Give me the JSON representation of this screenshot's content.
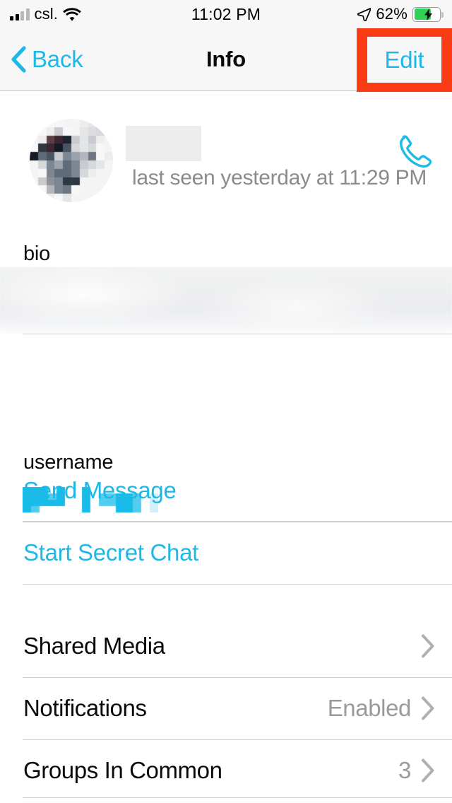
{
  "status_bar": {
    "carrier": "csl.",
    "time": "11:02 PM",
    "battery_percent": "62%",
    "signal_bars_filled": 2,
    "signal_bars_total": 4,
    "wifi_icon": "wifi-icon",
    "location_icon": "location-arrow-icon",
    "battery_icon": "battery-charging-icon",
    "battery_level": 62,
    "charging": true
  },
  "nav": {
    "back_label": "Back",
    "back_icon": "chevron-left-icon",
    "title": "Info",
    "edit_label": "Edit",
    "highlight_color": "#fa3c14"
  },
  "profile": {
    "avatar_icon": "avatar-pixelated",
    "name": "",
    "name_redacted": true,
    "status": "last seen yesterday at 11:29 PM",
    "call_icon": "phone-call-icon"
  },
  "sections": {
    "bio": {
      "label": "bio",
      "value": "",
      "value_redacted": true
    },
    "username": {
      "label": "username",
      "value": "",
      "value_redacted": true
    }
  },
  "actions": [
    {
      "label": "Send Message",
      "name": "send-message-action"
    },
    {
      "label": "Start Secret Chat",
      "name": "start-secret-chat-action"
    }
  ],
  "list_rows": [
    {
      "label": "Shared Media",
      "value": "",
      "chevron": "chevron-right-icon",
      "name": "shared-media-row"
    },
    {
      "label": "Notifications",
      "value": "Enabled",
      "chevron": "chevron-right-icon",
      "name": "notifications-row"
    },
    {
      "label": "Groups In Common",
      "value": "3",
      "chevron": "chevron-right-icon",
      "name": "groups-in-common-row"
    }
  ],
  "colors": {
    "accent": "#1eb8e6",
    "highlight": "#fa3c14",
    "separator": "#cfcfcf",
    "secondary_text": "#9a9a9a",
    "bar_background": "#f7f7f7"
  }
}
